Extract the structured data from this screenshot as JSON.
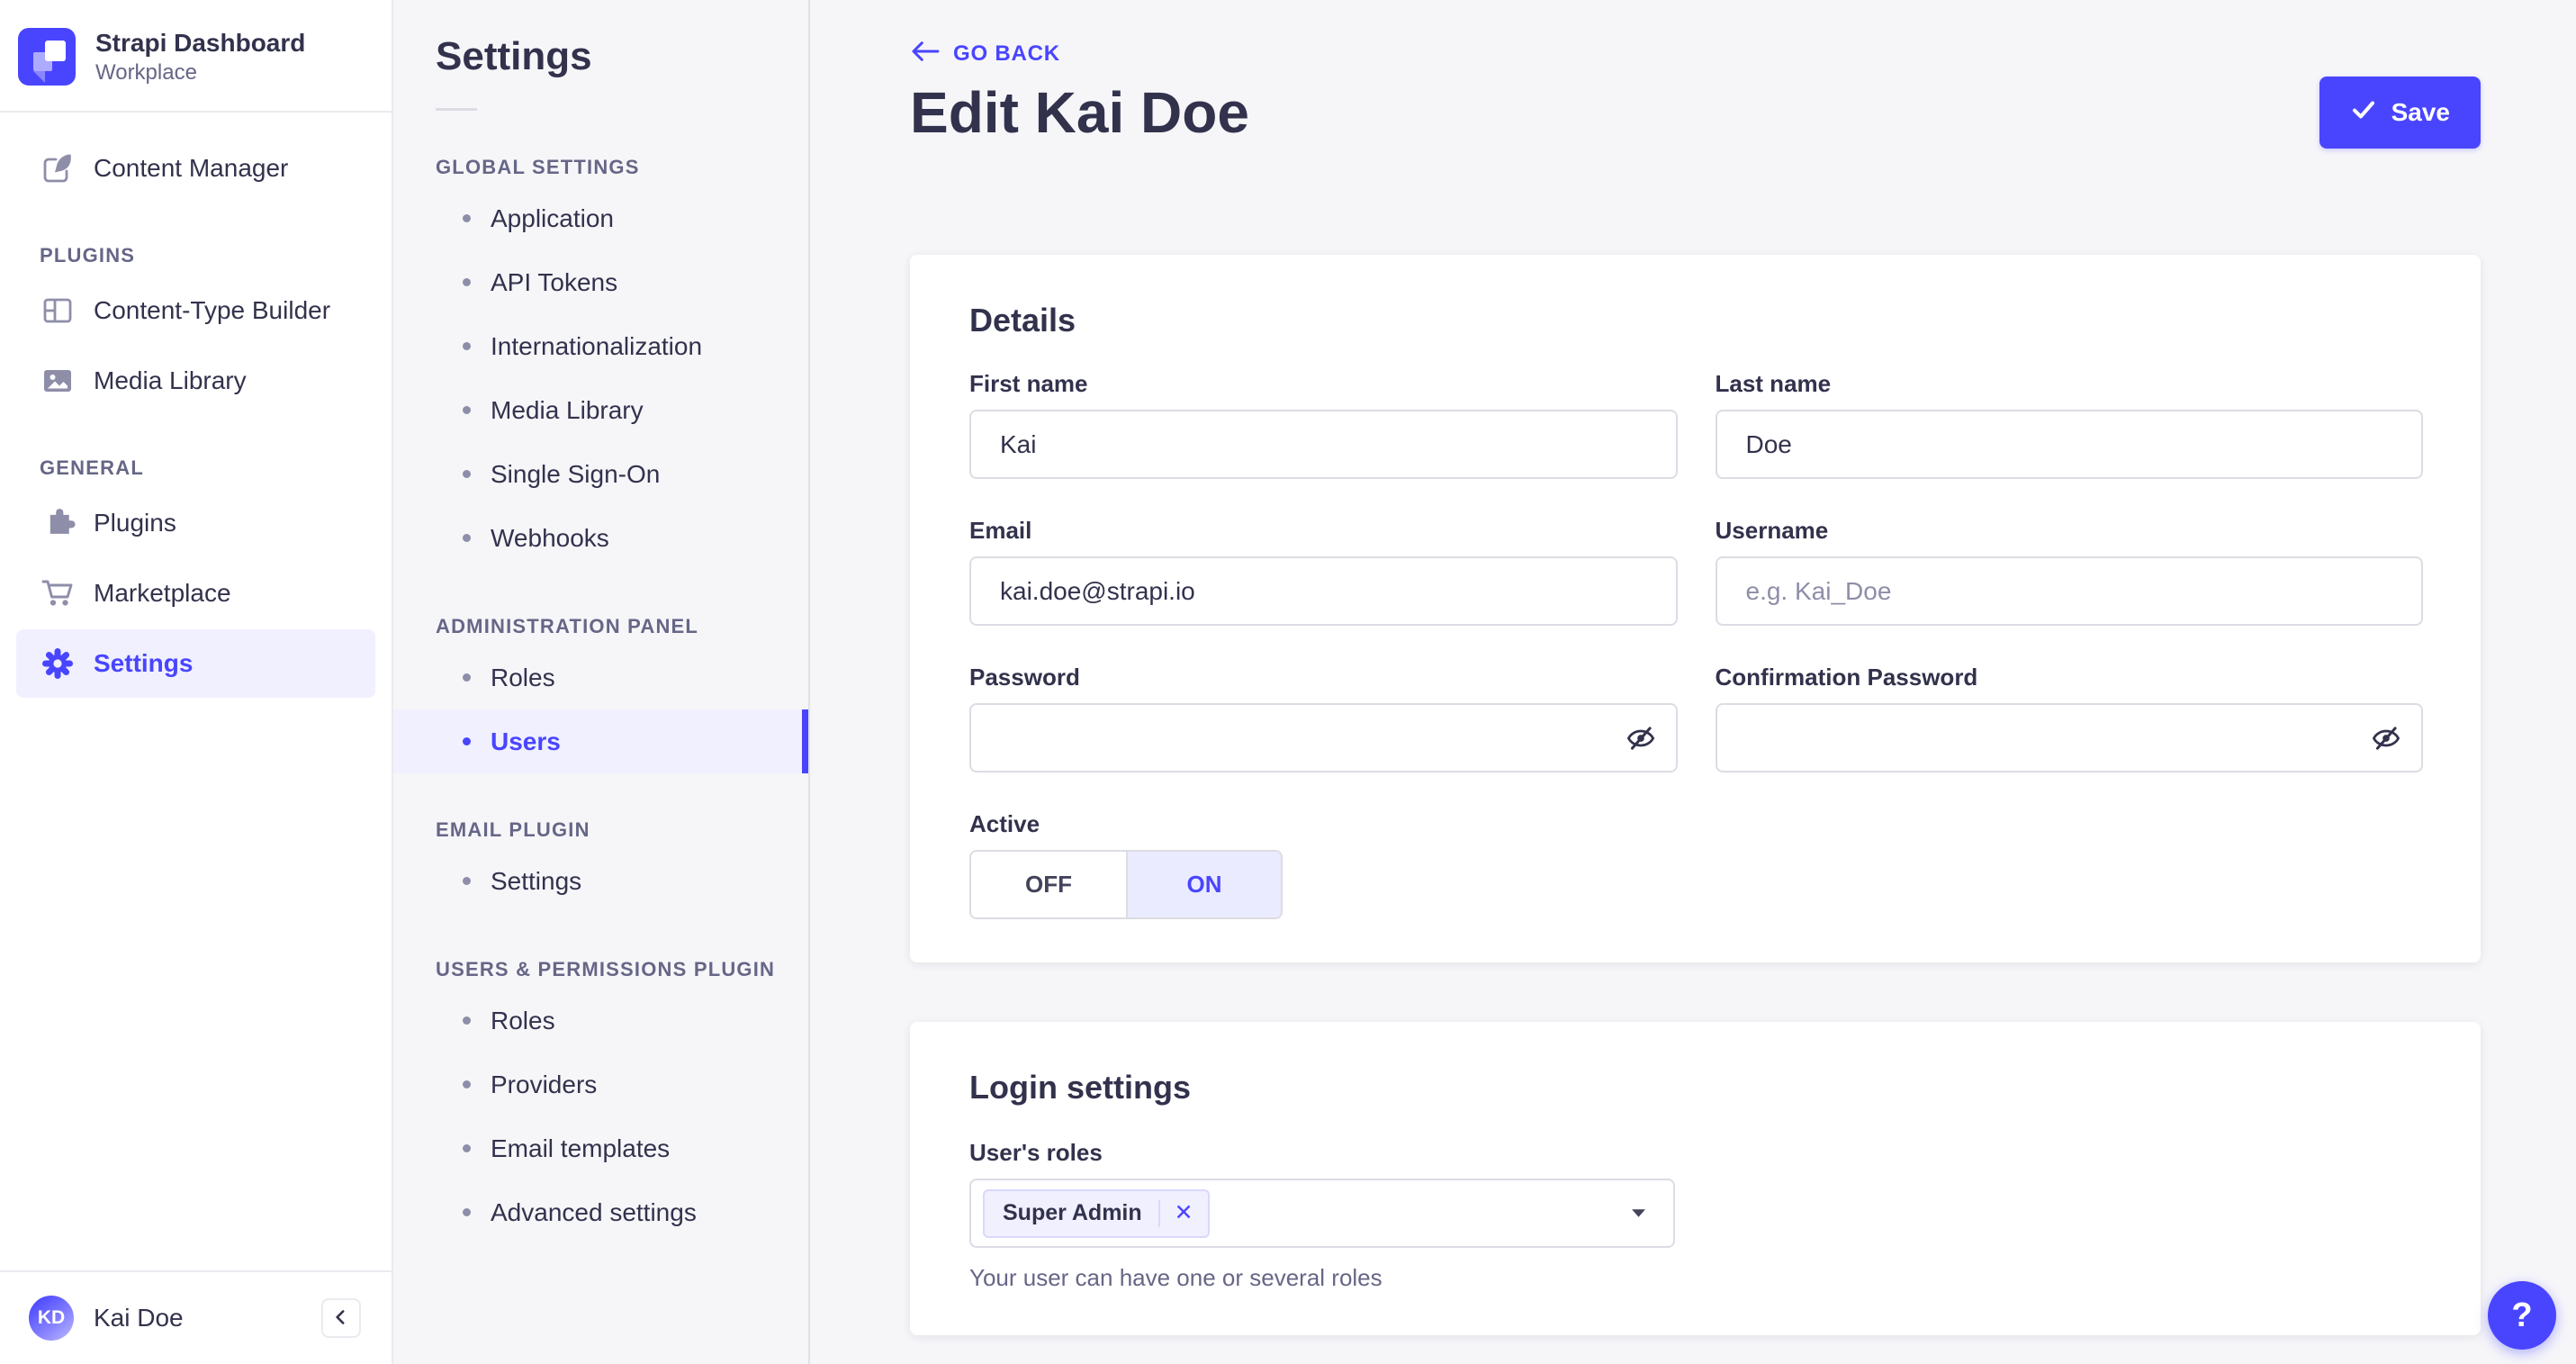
{
  "colors": {
    "accent": "#4945ff",
    "accent_light_bg": "#f0f0ff",
    "tag_border": "#d9d8ff",
    "text_primary": "#32324d",
    "text_muted": "#666687",
    "placeholder": "#8e8ea9",
    "app_bg": "#f6f6f9",
    "border": "#dcdce4"
  },
  "sidebar": {
    "brand": {
      "title": "Strapi Dashboard",
      "subtitle": "Workplace",
      "logo_icon": "strapi-logo"
    },
    "primary_items": [
      {
        "label": "Content Manager",
        "icon": "feather-icon",
        "active": false
      }
    ],
    "sections": [
      {
        "label": "PLUGINS",
        "items": [
          {
            "label": "Content-Type Builder",
            "icon": "layout-icon",
            "active": false
          },
          {
            "label": "Media Library",
            "icon": "media-icon",
            "active": false
          }
        ]
      },
      {
        "label": "GENERAL",
        "items": [
          {
            "label": "Plugins",
            "icon": "puzzle-icon",
            "active": false
          },
          {
            "label": "Marketplace",
            "icon": "cart-icon",
            "active": false
          },
          {
            "label": "Settings",
            "icon": "gear-icon",
            "active": true
          }
        ]
      }
    ],
    "user": {
      "initials": "KD",
      "name": "Kai Doe"
    },
    "collapse_icon": "chevron-left-icon"
  },
  "subsidebar": {
    "title": "Settings",
    "sections": [
      {
        "label": "GLOBAL SETTINGS",
        "items": [
          {
            "label": "Application",
            "active": false
          },
          {
            "label": "API Tokens",
            "active": false
          },
          {
            "label": "Internationalization",
            "active": false
          },
          {
            "label": "Media Library",
            "active": false
          },
          {
            "label": "Single Sign-On",
            "active": false
          },
          {
            "label": "Webhooks",
            "active": false
          }
        ]
      },
      {
        "label": "ADMINISTRATION PANEL",
        "items": [
          {
            "label": "Roles",
            "active": false
          },
          {
            "label": "Users",
            "active": true
          }
        ]
      },
      {
        "label": "EMAIL PLUGIN",
        "items": [
          {
            "label": "Settings",
            "active": false
          }
        ]
      },
      {
        "label": "USERS & PERMISSIONS PLUGIN",
        "items": [
          {
            "label": "Roles",
            "active": false
          },
          {
            "label": "Providers",
            "active": false
          },
          {
            "label": "Email templates",
            "active": false
          },
          {
            "label": "Advanced settings",
            "active": false
          }
        ]
      }
    ]
  },
  "main": {
    "back_label": "GO BACK",
    "back_icon": "back-arrow-icon",
    "title": "Edit Kai Doe",
    "save_label": "Save",
    "save_icon": "check-icon",
    "details": {
      "heading": "Details",
      "fields": [
        {
          "label": "First name",
          "value": "Kai",
          "password": false
        },
        {
          "label": "Last name",
          "value": "Doe",
          "password": false
        },
        {
          "label": "Email",
          "value": "kai.doe@strapi.io",
          "password": false
        },
        {
          "label": "Username",
          "value": "",
          "placeholder": "e.g. Kai_Doe",
          "password": false
        },
        {
          "label": "Password",
          "value": "",
          "password": true
        },
        {
          "label": "Confirmation Password",
          "value": "",
          "password": true
        }
      ],
      "password_icon": "eye-off-icon",
      "active": {
        "label": "Active",
        "off": "OFF",
        "on": "ON",
        "value": "ON"
      }
    },
    "login": {
      "heading": "Login settings",
      "roles_label": "User's roles",
      "selected_roles": [
        "Super Admin"
      ],
      "remove_icon": "close-icon",
      "dropdown_icon": "caret-down-icon",
      "helper": "Your user can have one or several roles"
    },
    "help_label": "?"
  }
}
